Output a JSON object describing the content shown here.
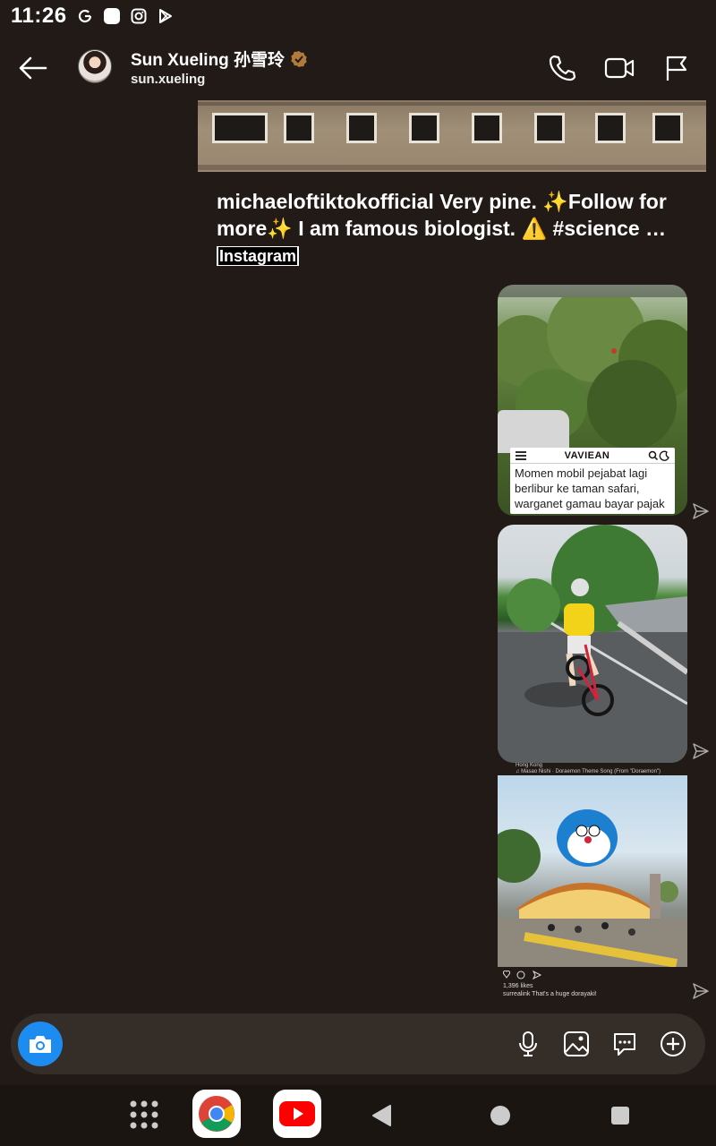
{
  "status_bar": {
    "time": "11:26",
    "icons": [
      "google-g-icon",
      "app-square-icon",
      "instagram-icon",
      "play-store-icon"
    ]
  },
  "header": {
    "contact_name": "Sun Xueling 孙雪玲",
    "contact_handle": "sun.xueling",
    "verified": true,
    "actions": [
      "phone-icon",
      "video-call-icon",
      "flag-icon"
    ]
  },
  "messages": {
    "shared_post": {
      "caption": "michaeloftiktokofficial Very pine. ✨Follow for more✨ I am famous biologist. ⚠️ #science …",
      "source": "Instagram"
    },
    "reel1": {
      "news_brand": "VAVIEAN",
      "news_text": "Momen mobil pejabat lagi berlibur ke taman safari, warganet gamau bayar pajak"
    },
    "reel3": {
      "location": "Hong Kong",
      "song": "♫ Masao Nishi · Doraemon Theme Song (From \"Doraemon\")",
      "likes": "1,396 likes",
      "comment": "surrealink That's a huge dorayaki!"
    }
  },
  "composer": {
    "placeholder": "",
    "actions": [
      "microphone-icon",
      "gallery-icon",
      "sticker-icon",
      "add-icon"
    ]
  },
  "navbar": {
    "items": [
      "app-drawer-icon",
      "chrome-icon",
      "youtube-icon",
      "back-icon",
      "home-icon",
      "recents-icon"
    ]
  },
  "colors": {
    "background": "#211a16",
    "composer_bg": "#352d28",
    "camera_accent": "#1d8cf0",
    "verified_badge": "#b07a3a"
  }
}
